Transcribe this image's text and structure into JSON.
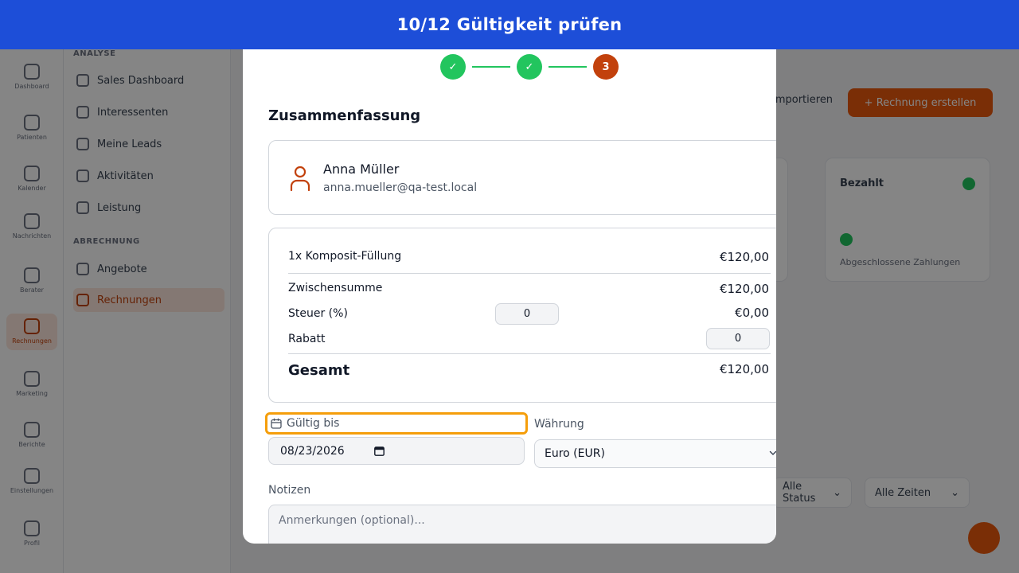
{
  "banner": {
    "title": "10/12 Gültigkeit prüfen"
  },
  "background": {
    "rail": [
      "Dashboard",
      "Patienten",
      "Kalender",
      "Nachrichten",
      "Berater",
      "Rechnungen",
      "Marketing",
      "Berichte",
      "Einstellungen",
      "Profil"
    ],
    "sub_sections": [
      {
        "heading": "ANALYSE",
        "items": [
          "Sales Dashboard",
          "Interessenten",
          "Meine Leads",
          "Aktivitäten",
          "Leistung"
        ]
      },
      {
        "heading": "ABRECHNUNG",
        "items": [
          "Angebote",
          "Rechnungen"
        ]
      }
    ],
    "header_secondary": "Importieren",
    "header_primary": "+ Rechnung erstellen",
    "card_title": "Bezahlt",
    "card_sub": "Abgeschlossene Zahlungen",
    "filter_status": "Alle Status",
    "filter_time": "Alle Zeiten"
  },
  "modal": {
    "steps": [
      {
        "label": "✓",
        "state": "done"
      },
      {
        "label": "✓",
        "state": "done"
      },
      {
        "label": "3",
        "state": "current"
      }
    ],
    "section_title": "Zusammenfassung",
    "client": {
      "icon": "person-icon",
      "name": "Anna Müller",
      "email": "anna.mueller@qa-test.local"
    },
    "line_item": {
      "label": "1x Komposit-Füllung",
      "amount": "€120,00"
    },
    "subtotal": {
      "label": "Zwischensumme",
      "amount": "€120,00"
    },
    "tax": {
      "label": "Steuer (%)",
      "input": "0",
      "amount": "€0,00"
    },
    "discount": {
      "label": "Rabatt",
      "input": "0"
    },
    "total": {
      "label": "Gesamt",
      "amount": "€120,00"
    },
    "valid_until": {
      "label": "Gültig bis",
      "value": "08/23/2026"
    },
    "currency": {
      "label": "Währung",
      "value": "Euro (EUR)"
    },
    "notes": {
      "label": "Notizen",
      "placeholder": "Anmerkungen (optional)..."
    }
  },
  "colors": {
    "banner": "#1d4ed8",
    "accent": "#c2410c",
    "success": "#22c55e",
    "highlight": "#f59e0b"
  }
}
